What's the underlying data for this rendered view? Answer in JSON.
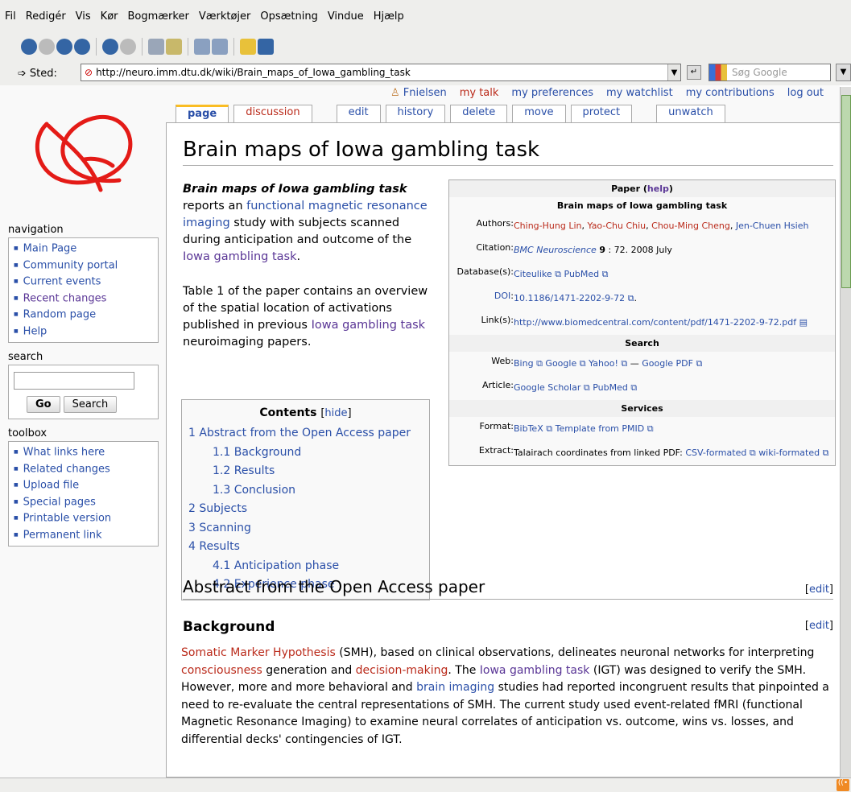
{
  "browser": {
    "menu": [
      "Fil",
      "Redigér",
      "Vis",
      "Kør",
      "Bogmærker",
      "Værktøjer",
      "Opsætning",
      "Vindue",
      "Hjælp"
    ],
    "location_label": "Sted:",
    "url": "http://neuro.imm.dtu.dk/wiki/Brain_maps_of_Iowa_gambling_task",
    "search_placeholder": "Søg Google"
  },
  "personal": {
    "user": "Fnielsen",
    "talk": "my talk",
    "preferences": "my preferences",
    "watchlist": "my watchlist",
    "contributions": "my contributions",
    "logout": "log out"
  },
  "tabs": [
    "page",
    "discussion",
    "edit",
    "history",
    "delete",
    "move",
    "protect",
    "unwatch"
  ],
  "sidebar": {
    "navigation_title": "navigation",
    "navigation": [
      "Main Page",
      "Community portal",
      "Current events",
      "Recent changes",
      "Random page",
      "Help"
    ],
    "search_title": "search",
    "go": "Go",
    "search": "Search",
    "toolbox_title": "toolbox",
    "toolbox": [
      "What links here",
      "Related changes",
      "Upload file",
      "Special pages",
      "Printable version",
      "Permanent link"
    ]
  },
  "article": {
    "title": "Brain maps of Iowa gambling task",
    "p1": {
      "bold": "Brain maps of Iowa gambling task",
      "t1": " reports an ",
      "link1": "functional magnetic resonance imaging",
      "t2": " study with subjects scanned during anticipation and outcome of the ",
      "link2": "Iowa gambling task",
      "t3": "."
    },
    "p2": {
      "t1": "Table 1 of the paper contains an overview of the spatial location of activations published in previous ",
      "link1": "Iowa gambling task",
      "t2": " neuroimaging papers."
    }
  },
  "infobox": {
    "header": "Paper",
    "help": "help",
    "title": "Brain maps of Iowa gambling task",
    "authors_label": "Authors:",
    "authors": [
      "Ching-Hung Lin",
      "Yao-Chu Chiu",
      "Chou-Ming Cheng",
      "Jen-Chuen Hsieh"
    ],
    "citation_label": "Citation:",
    "journal": "BMC Neuroscience",
    "volume": "9",
    "citation_rest": " : 72. 2008 July",
    "database_label": "Database(s):",
    "databases": [
      "Citeulike",
      "PubMed"
    ],
    "doi_label": "DOI",
    "doi": "10.1186/1471-2202-9-72",
    "links_label": "Link(s):",
    "link": "http://www.biomedcentral.com/content/pdf/1471-2202-9-72.pdf",
    "search_header": "Search",
    "web_label": "Web:",
    "web": [
      "Bing",
      "Google",
      "Yahoo!"
    ],
    "web_dash": " — ",
    "google_pdf": "Google PDF",
    "article_label": "Article:",
    "article": [
      "Google Scholar",
      "PubMed"
    ],
    "services_header": "Services",
    "format_label": "Format:",
    "format": [
      "BibTeX",
      "Template from PMID"
    ],
    "extract_label": "Extract:",
    "extract_text": "Talairach coordinates from linked PDF: ",
    "extract": [
      "CSV-formated",
      "wiki-formated"
    ]
  },
  "toc": {
    "title": "Contents",
    "hide": "hide",
    "items": [
      {
        "num": "1",
        "label": "Abstract from the Open Access paper",
        "level": 1
      },
      {
        "num": "1.1",
        "label": "Background",
        "level": 2
      },
      {
        "num": "1.2",
        "label": "Results",
        "level": 2
      },
      {
        "num": "1.3",
        "label": "Conclusion",
        "level": 2
      },
      {
        "num": "2",
        "label": "Subjects",
        "level": 1
      },
      {
        "num": "3",
        "label": "Scanning",
        "level": 1
      },
      {
        "num": "4",
        "label": "Results",
        "level": 1
      },
      {
        "num": "4.1",
        "label": "Anticipation phase",
        "level": 2
      },
      {
        "num": "4.2",
        "label": "Experience phase",
        "level": 2
      }
    ]
  },
  "section": {
    "h2": "Abstract from the Open Access paper",
    "h3": "Background",
    "edit": "edit",
    "bg": {
      "l1": "Somatic Marker Hypothesis",
      "t1": " (SMH), based on clinical observations, delineates neuronal networks for interpreting ",
      "l2": "consciousness",
      "t2": " generation and ",
      "l3": "decision-making",
      "t3": ". The ",
      "l4": "Iowa gambling task",
      "t4": " (IGT) was designed to verify the SMH. However, more and more behavioral and ",
      "l5": "brain imaging",
      "t5": " studies had reported incongruent results that pinpointed a need to re-evaluate the central representations of SMH. The current study used event-related fMRI (functional Magnetic Resonance Imaging) to examine neural correlates of anticipation vs. outcome, wins vs. losses, and differential decks' contingencies of IGT."
    }
  }
}
